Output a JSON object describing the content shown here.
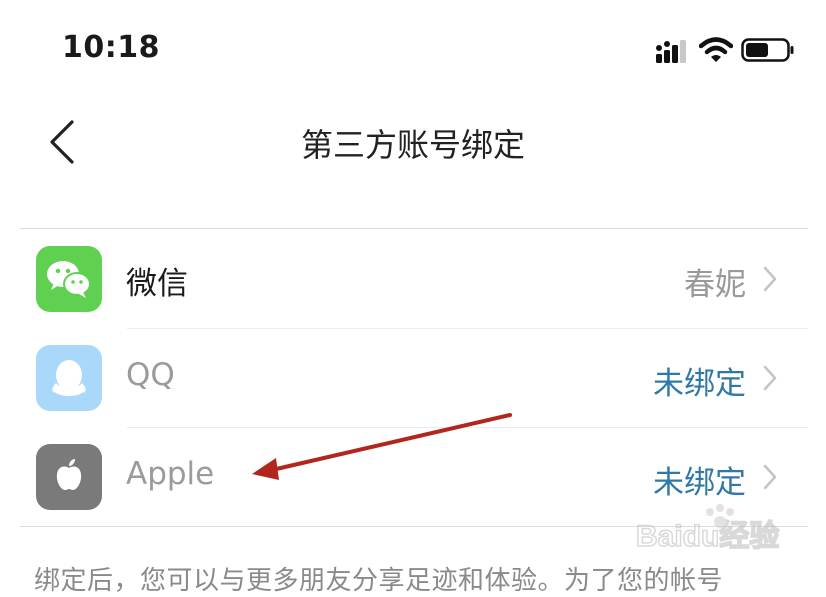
{
  "status_bar": {
    "time": "10:18"
  },
  "nav": {
    "title": "第三方账号绑定"
  },
  "accounts": [
    {
      "label": "微信",
      "value": "春妮",
      "icon": "wechat-icon"
    },
    {
      "label": "QQ",
      "value": "未绑定",
      "icon": "qq-icon"
    },
    {
      "label": "Apple",
      "value": "未绑定",
      "icon": "apple-icon"
    }
  ],
  "footer": {
    "text": "绑定后，您可以与更多朋友分享足迹和体验。为了您的帐号"
  },
  "watermark": {
    "text": "Baidu经验"
  },
  "colors": {
    "wechat": "#5fd04f",
    "qq": "#a9d8fb",
    "apple": "#7a7a7a",
    "link_blue": "#3078a8",
    "annotation_arrow": "#b3261e"
  }
}
